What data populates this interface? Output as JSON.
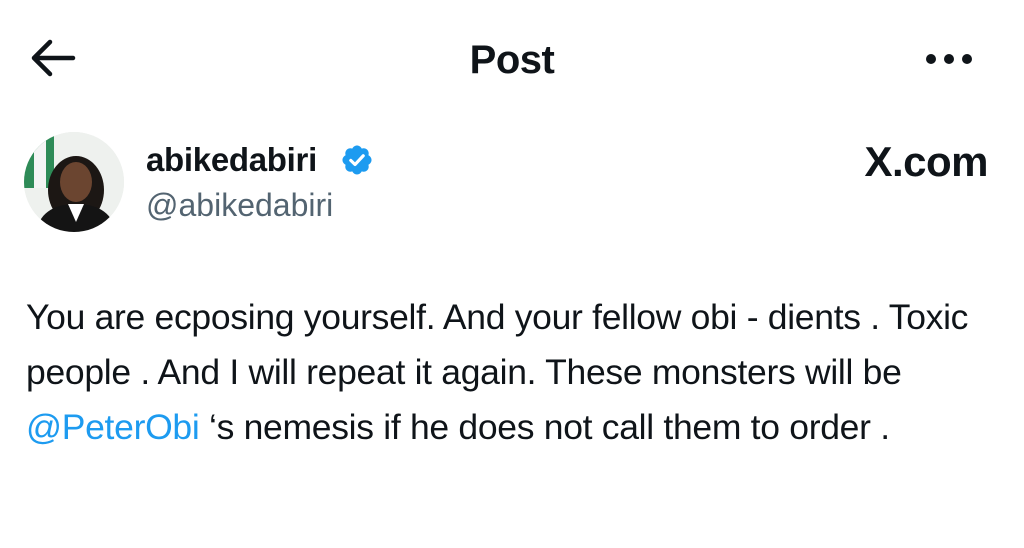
{
  "header": {
    "title": "Post",
    "back_icon": "arrow-left-icon",
    "more_icon": "more-horizontal-icon"
  },
  "author": {
    "display_name": "abikedabiri",
    "handle": "@abikedabiri",
    "verified": true,
    "verified_color": "#1d9bf0"
  },
  "brand": {
    "label": "X.com"
  },
  "post": {
    "text_before_mention": "You are ecposing yourself. And your fellow obi - dients . Toxic people . And I will repeat it again. These monsters will be ",
    "mention": "@PeterObi",
    "text_after_mention": " ‘s nemesis if he does not call them to order .",
    "mention_color": "#1d9bf0"
  }
}
